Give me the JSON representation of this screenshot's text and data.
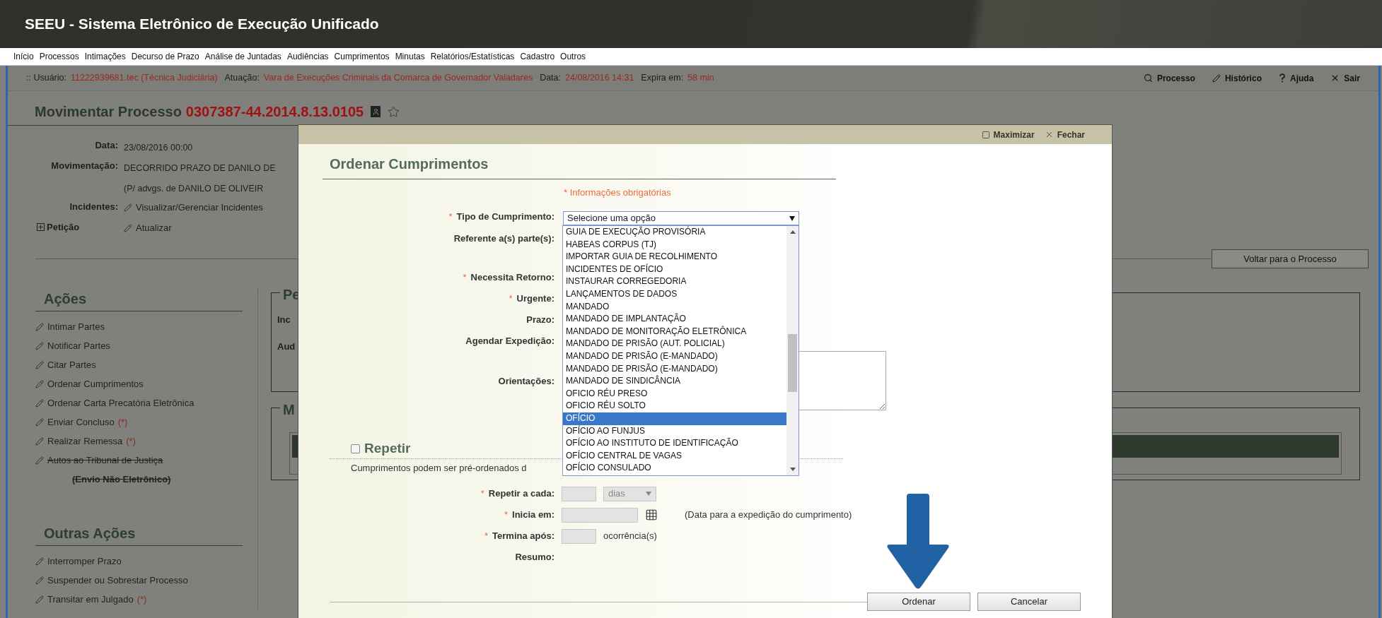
{
  "app": {
    "title": "SEEU - Sistema Eletrônico de Execução Unificado"
  },
  "menu": [
    "Início",
    "Processos",
    "Intimações",
    "Decurso de Prazo",
    "Análise de Juntadas",
    "Audiências",
    "Cumprimentos",
    "Minutas",
    "Relatórios/Estatísticas",
    "Cadastro",
    "Outros"
  ],
  "session": {
    "fields": [
      {
        "label": ":: Usuário:",
        "value": "11222939681.tec (Técnica Judiciária)"
      },
      {
        "label": "Atuação:",
        "value": "Vara de Execuções Criminais da Comarca de Governador Valadares"
      },
      {
        "label": "Data:",
        "value": "24/08/2016 14:31"
      },
      {
        "label": "Expira em:",
        "value": "58 min"
      }
    ],
    "links": [
      "Processo",
      "Histórico",
      "Ajuda",
      "Sair"
    ]
  },
  "page": {
    "title": "Movimentar Processo",
    "number": "0307387-44.2014.8.13.0105",
    "details": [
      {
        "kind": "text",
        "label": "Data:",
        "lines": [
          "23/08/2016 00:00"
        ]
      },
      {
        "kind": "text",
        "label": "Movimentação:",
        "lines": [
          "DECORRIDO PRAZO DE DANILO DE",
          "(P/ advgs. de DANILO DE OLIVEIR"
        ]
      },
      {
        "kind": "link",
        "label": "Incidentes:",
        "link": "Visualizar/Gerenciar Incidentes"
      },
      {
        "kind": "expander",
        "label": "Petição",
        "link": "Atualizar",
        "expanded": false
      }
    ],
    "back_button": "Voltar para o Processo"
  },
  "actions": {
    "title": "Ações",
    "items": [
      {
        "label": "Intimar Partes",
        "disabled": false
      },
      {
        "label": "Notificar Partes",
        "disabled": false
      },
      {
        "label": "Citar Partes",
        "disabled": false
      },
      {
        "label": "Ordenar Cumprimentos",
        "disabled": false
      },
      {
        "label": "Ordenar Carta Precatória Eletrônica",
        "disabled": false
      },
      {
        "label": "Enviar Concluso",
        "note": "(*)",
        "disabled": false
      },
      {
        "label": "Realizar Remessa",
        "note": "(*)",
        "disabled": false
      },
      {
        "label": "Autos ao Tribunal de Justiça",
        "sublabel": "(Envio Não Eletrônico)",
        "disabled": true
      }
    ]
  },
  "other_actions": {
    "title": "Outras Ações",
    "items": [
      {
        "label": "Interromper Prazo",
        "disabled": false
      },
      {
        "label": "Suspender ou Sobrestar Processo",
        "disabled": false
      },
      {
        "label": "Transitar em Julgado",
        "note": "(*)",
        "disabled": false
      }
    ]
  },
  "panel_1": {
    "title": "Pe",
    "labels": [
      "Inc",
      "Aud"
    ]
  },
  "panel_2": {
    "title": "M"
  },
  "dialog": {
    "controls": [
      "Maximizar",
      "Fechar"
    ],
    "title": "Ordenar Cumprimentos",
    "required_note": "* Informações obrigatórias",
    "fields": [
      {
        "kind": "select",
        "mark": "*",
        "label": "Tipo de Cumprimento:",
        "value": "Selecione uma opção"
      },
      {
        "kind": "multi",
        "label": "Referente a(s) parte(s):"
      },
      {
        "kind": "radio",
        "mark": "*",
        "label": "Necessita Retorno:"
      },
      {
        "kind": "radio",
        "mark": "*",
        "label": "Urgente:"
      },
      {
        "kind": "text",
        "label": "Prazo:"
      },
      {
        "kind": "date",
        "label": "Agendar Expedição:"
      },
      {
        "kind": "textarea",
        "label": "Orientações:"
      }
    ],
    "options": [
      {
        "label": "GUIA DE EXECUÇÃO PROVISÓRIA",
        "selected": false
      },
      {
        "label": "HABEAS CORPUS (TJ)",
        "selected": false
      },
      {
        "label": "IMPORTAR GUIA DE RECOLHIMENTO",
        "selected": false
      },
      {
        "label": "INCIDENTES DE OFÍCIO",
        "selected": false
      },
      {
        "label": "INSTAURAR CORREGEDORIA",
        "selected": false
      },
      {
        "label": "LANÇAMENTOS DE DADOS",
        "selected": false
      },
      {
        "label": "MANDADO",
        "selected": false
      },
      {
        "label": "MANDADO DE IMPLANTAÇÃO",
        "selected": false
      },
      {
        "label": "MANDADO DE MONITORAÇÃO ELETRÔNICA",
        "selected": false
      },
      {
        "label": "MANDADO DE PRISÃO (AUT. POLICIAL)",
        "selected": false
      },
      {
        "label": "MANDADO DE PRISÃO (E-MANDADO)",
        "selected": false
      },
      {
        "label": "MANDADO DE PRISÃO (E-MANDADO)",
        "selected": false
      },
      {
        "label": "MANDADO DE SINDICÂNCIA",
        "selected": false
      },
      {
        "label": "OFICIO RÉU PRESO",
        "selected": false
      },
      {
        "label": "OFICIO RÉU SOLTO",
        "selected": false
      },
      {
        "label": "OFÍCIO",
        "selected": true
      },
      {
        "label": "OFÍCIO AO FUNJUS",
        "selected": false
      },
      {
        "label": "OFÍCIO AO INSTITUTO DE IDENTIFICAÇÃO",
        "selected": false
      },
      {
        "label": "OFÍCIO CENTRAL DE VAGAS",
        "selected": false
      },
      {
        "label": "OFÍCIO CONSULADO",
        "selected": false
      }
    ],
    "repeat": {
      "label": "Repetir",
      "checked": false,
      "note": "Cumprimentos podem ser pré-ordenados d",
      "fields": [
        {
          "kind": "interval",
          "mark": "*",
          "label": "Repetir a cada:",
          "unit": "dias"
        },
        {
          "kind": "date",
          "mark": "*",
          "label": "Inicia em:",
          "hint": "(Data para a expedição do cumprimento)"
        },
        {
          "kind": "count",
          "mark": "*",
          "label": "Termina após:",
          "suffix": "ocorrência(s)"
        },
        {
          "kind": "summary",
          "label": "Resumo:"
        }
      ]
    },
    "buttons": [
      "Ordenar",
      "Cancelar"
    ]
  }
}
